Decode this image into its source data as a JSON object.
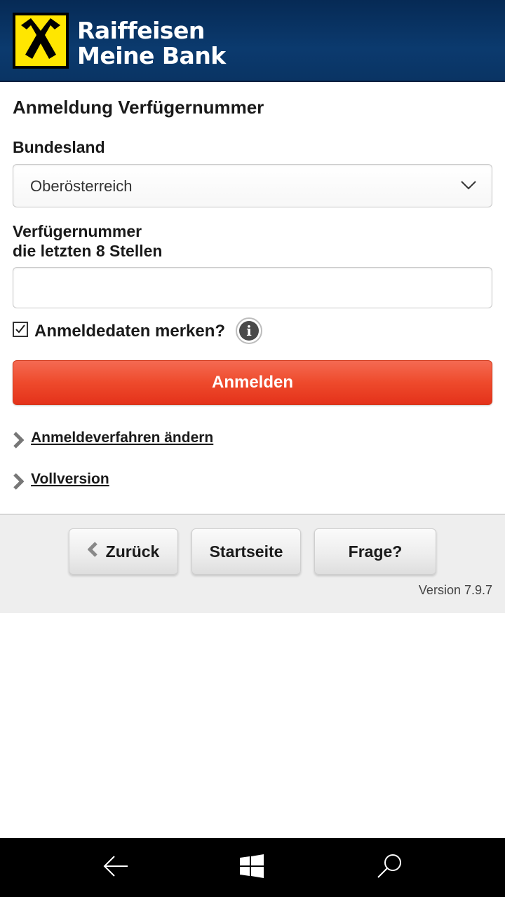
{
  "header": {
    "brand_line1": "Raiffeisen",
    "brand_line2": "Meine Bank",
    "logo_icon": "raiffeisen-gable-cross-logo",
    "colors": {
      "background": "#0b3a6e",
      "logo_yellow": "#ffe600"
    }
  },
  "form": {
    "title": "Anmeldung Verfügernummer",
    "state_label": "Bundesland",
    "state_value": "Oberösterreich",
    "number_label_line1": "Verfügernummer",
    "number_label_line2": "die letzten 8 Stellen",
    "number_value": "",
    "remember_label": "Anmeldedaten merken?",
    "remember_checked": true,
    "info_icon": "info-icon",
    "submit_label": "Anmelden",
    "submit_color": "#ee4a2c"
  },
  "links": [
    {
      "label": "Anmeldeverfahren ändern"
    },
    {
      "label": "Vollversion"
    }
  ],
  "footer": {
    "back_label": "Zurück",
    "home_label": "Startseite",
    "question_label": "Frage?",
    "version": "Version 7.9.7"
  },
  "system_nav": {
    "icons": [
      "back-arrow-icon",
      "windows-start-icon",
      "search-icon"
    ]
  }
}
